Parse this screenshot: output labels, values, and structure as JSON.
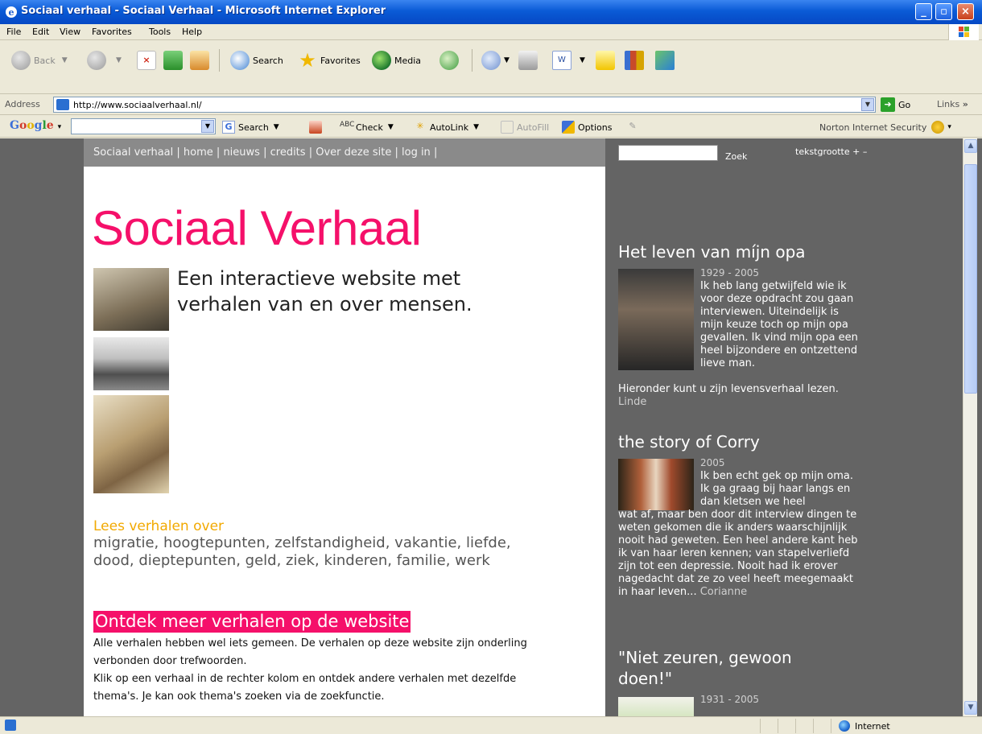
{
  "window": {
    "title": "Sociaal verhaal - Sociaal Verhaal - Microsoft Internet Explorer",
    "controls": [
      "minimize",
      "maximize",
      "close"
    ]
  },
  "menubar": {
    "items": [
      "File",
      "Edit",
      "View",
      "Favorites",
      "Tools",
      "Help"
    ]
  },
  "toolbar": {
    "back": "Back",
    "search": "Search",
    "favorites": "Favorites",
    "media": "Media"
  },
  "address": {
    "label": "Address",
    "url": "http://www.sociaalverhaal.nl/",
    "go": "Go",
    "links": "Links"
  },
  "googlebar": {
    "logo": "Google",
    "search": "Search",
    "check": "Check",
    "autolink": "AutoLink",
    "autofill": "AutoFill",
    "options": "Options",
    "norton": "Norton Internet Security"
  },
  "site": {
    "nav": [
      "Sociaal verhaal",
      "home",
      "nieuws",
      "credits",
      "Over deze site",
      "log in"
    ],
    "title": "Sociaal Verhaal",
    "tagline": "Een interactieve website met verhalen van en over mensen.",
    "lees_over": "Lees verhalen over",
    "topics": [
      "migratie",
      "hoogtepunten",
      "zelfstandigheid",
      "vakantie",
      "liefde",
      "dood",
      "dieptepunten",
      "geld",
      "ziek",
      "kinderen",
      "familie",
      "werk"
    ],
    "ontdek": "Ontdek meer verhalen op de website",
    "body": [
      "Alle verhalen hebben wel iets gemeen. De verhalen op deze website zijn onderling verbonden door trefwoorden.",
      "Klik op een verhaal in de rechter kolom en ontdek andere verhalen met dezelfde thema's. Je kan ook thema's zoeken via de zoekfunctie."
    ]
  },
  "sidebar": {
    "search_placeholder": "",
    "zoek": "Zoek",
    "textsize": "tekstgrootte + –",
    "stories": [
      {
        "title": "Het leven van míjn opa",
        "date": "1929 - 2005",
        "text": "Ik heb lang getwijfeld wie ik voor deze opdracht zou gaan interviewen. Uiteindelijk is mijn keuze toch op mijn opa gevallen. Ik vind mijn opa een heel bijzondere en ontzettend lieve man. Hieronder kunt u zijn levensverhaal lezen.",
        "author": "Linde"
      },
      {
        "title": "the story of Corry",
        "date": "2005",
        "text": "Ik ben echt gek op mijn oma. Ik ga graag bij haar langs en dan kletsen we heel wat af, maar ben door dit interview dingen te weten gekomen die ik anders waarschijnlijk nooit had geweten. Een heel andere kant heb ik van haar leren kennen; van stapelverliefd zijn tot een depressie. Nooit had ik erover nagedacht dat ze zo veel heeft meegemaakt in haar leven...",
        "author": "Corianne"
      },
      {
        "title": "\"Niet zeuren, gewoon doen!\"",
        "date": "1931 - 2005",
        "text": "",
        "author": ""
      }
    ]
  },
  "statusbar": {
    "zone": "Internet"
  }
}
